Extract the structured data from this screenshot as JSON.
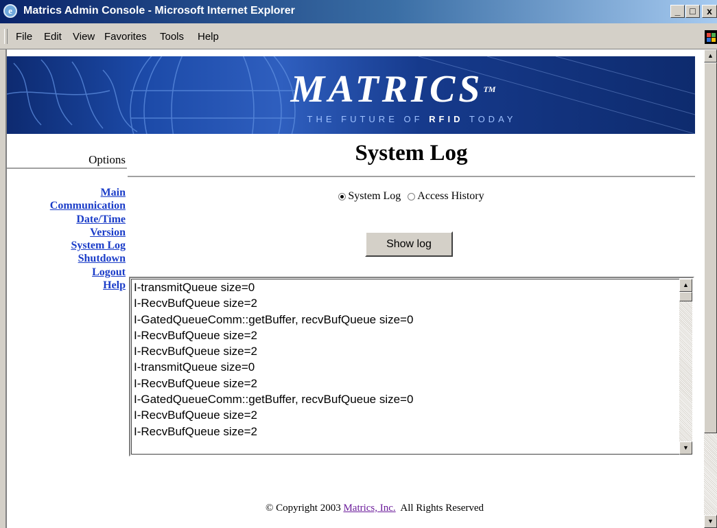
{
  "window": {
    "title": "Matrics Admin Console - Microsoft Internet Explorer",
    "controls": {
      "minimize": "_",
      "maximize": "□",
      "close": "x"
    }
  },
  "menu": [
    "File",
    "Edit",
    "View",
    "Favorites",
    "Tools",
    "Help"
  ],
  "banner": {
    "logo": "MATRICS",
    "trademark": "TM",
    "tagline_pre": "THE FUTURE OF ",
    "tagline_bold": "RFID",
    "tagline_post": " TODAY"
  },
  "sidebar": {
    "heading": "Options",
    "links": [
      "Main",
      "Communication",
      "Date/Time",
      "Version",
      "System Log",
      "Shutdown",
      "Logout",
      "Help"
    ]
  },
  "main": {
    "title": "System Log",
    "radios": [
      {
        "label": "System Log",
        "checked": true
      },
      {
        "label": "Access History",
        "checked": false
      }
    ],
    "show_button": "Show log",
    "log_lines": [
      "I-transmitQueue size=0",
      "I-RecvBufQueue size=2",
      "I-GatedQueueComm::getBuffer, recvBufQueue size=0",
      "I-RecvBufQueue size=2",
      "I-RecvBufQueue size=2",
      "I-transmitQueue size=0",
      "I-RecvBufQueue size=2",
      "I-GatedQueueComm::getBuffer, recvBufQueue size=0",
      "I-RecvBufQueue size=2",
      "I-RecvBufQueue size=2"
    ]
  },
  "footer": {
    "prefix": "© Copyright 2003 ",
    "company_link": "Matrics, Inc.",
    "suffix": "  All Rights Reserved"
  },
  "colors": {
    "titlebar_start": "#0a246a",
    "link": "#1a3cc8",
    "visited_link": "#6a1a9a",
    "chrome": "#d4d0c8"
  }
}
